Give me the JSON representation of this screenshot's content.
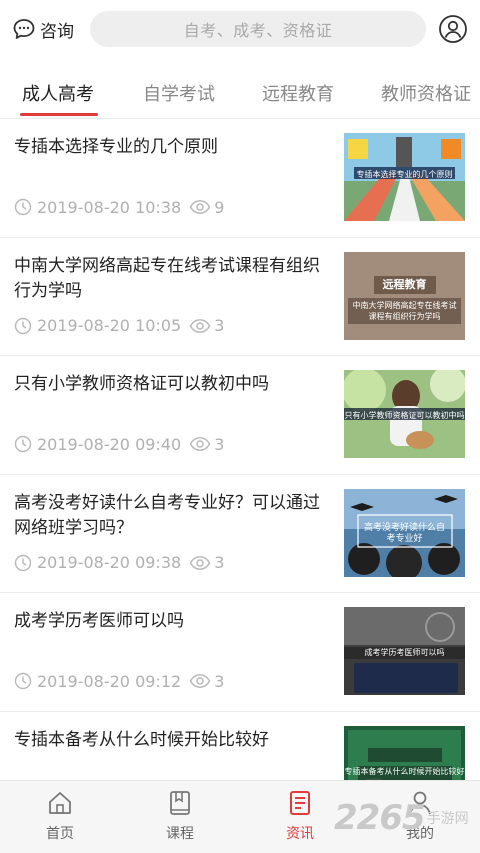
{
  "header": {
    "consult_label": "咨询",
    "search_placeholder": "自考、成考、资格证"
  },
  "tabs": [
    {
      "label": "成人高考",
      "active": true
    },
    {
      "label": "自学考试",
      "active": false
    },
    {
      "label": "远程教育",
      "active": false
    },
    {
      "label": "教师资格证",
      "active": false
    }
  ],
  "articles": [
    {
      "title": "专插本选择专业的几个原则",
      "date": "2019-08-20 10:38",
      "views": "9",
      "thumb_caption": "专插本选择专业的几个原则"
    },
    {
      "title": "中南大学网络高起专在线考试课程有组织行为学吗",
      "date": "2019-08-20 10:05",
      "views": "3",
      "thumb_tag": "远程教育",
      "thumb_caption": "中南大学网络高起专在线考试课程有组织行为学吗"
    },
    {
      "title": "只有小学教师资格证可以教初中吗",
      "date": "2019-08-20 09:40",
      "views": "3",
      "thumb_caption": "只有小学教师资格证可以教初中吗"
    },
    {
      "title": "高考没考好读什么自考专业好？可以通过网络班学习吗？",
      "date": "2019-08-20 09:38",
      "views": "3",
      "thumb_caption": "高考没考好读什么自考专业好"
    },
    {
      "title": "成考学历考医师可以吗",
      "date": "2019-08-20 09:12",
      "views": "3",
      "thumb_caption": "成考学历考医师可以吗"
    },
    {
      "title": "专插本备考从什么时候开始比较好",
      "date": "",
      "views": "",
      "thumb_caption": "专插本备考从什么时候开始比较好"
    }
  ],
  "bottom_nav": [
    {
      "label": "首页",
      "icon": "home-icon",
      "active": false
    },
    {
      "label": "课程",
      "icon": "book-icon",
      "active": false
    },
    {
      "label": "资讯",
      "icon": "news-icon",
      "active": true
    },
    {
      "label": "我的",
      "icon": "person-icon",
      "active": false
    }
  ],
  "watermark": {
    "number": "2265",
    "text": "手游网"
  },
  "colors": {
    "accent": "#e2393a",
    "muted": "#b0b0b0",
    "search_bg": "#eeeeee"
  }
}
